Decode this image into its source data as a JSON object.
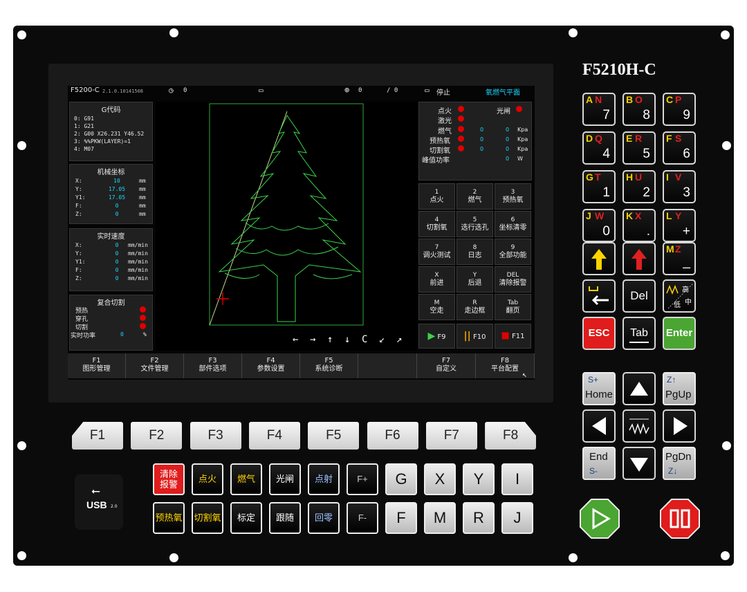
{
  "model": "F5210H-C",
  "status_bar": {
    "product": "F5200-C",
    "version": "2.1.0.10141508",
    "speed": "0",
    "coord_a": "0",
    "coord_b": "/ 0",
    "state": "停止",
    "mode": "氧燃气平面"
  },
  "gcode": {
    "title": "G代码",
    "lines": [
      "0: G91",
      "1: G21",
      "2: G00 X26.231 Y46.52",
      "3: %%PKW(LAYER)=1",
      "4: M07"
    ]
  },
  "machine_coords": {
    "title": "机械坐标",
    "rows": [
      {
        "axis": "X:",
        "value": "10",
        "unit": "mm"
      },
      {
        "axis": "Y:",
        "value": "17.05",
        "unit": "mm"
      },
      {
        "axis": "Y1:",
        "value": "17.05",
        "unit": "mm"
      },
      {
        "axis": "F:",
        "value": "0",
        "unit": "mm"
      },
      {
        "axis": "Z:",
        "value": "0",
        "unit": "mm"
      }
    ]
  },
  "real_speed": {
    "title": "实时速度",
    "rows": [
      {
        "axis": "X:",
        "value": "0",
        "unit": "mm/min"
      },
      {
        "axis": "Y:",
        "value": "0",
        "unit": "mm/min"
      },
      {
        "axis": "Y1:",
        "value": "0",
        "unit": "mm/min"
      },
      {
        "axis": "F:",
        "value": "0",
        "unit": "mm/min"
      },
      {
        "axis": "Z:",
        "value": "0",
        "unit": "mm/min"
      }
    ]
  },
  "compound_cut": {
    "title": "复合切割",
    "items": [
      "预热",
      "穿孔",
      "切割"
    ],
    "power_label": "实时功率",
    "power_value": "0",
    "power_unit": "%"
  },
  "io_status": {
    "ignite": "点火",
    "shutter": "光闸",
    "laser": "激光",
    "gas": "燃气",
    "preheat_o2": "预热氧",
    "cut_o2": "切割氧",
    "peak_power": "峰值功率",
    "v0": "0",
    "kpa": "Kpa",
    "w": "W"
  },
  "soft_keys": [
    {
      "num": "1",
      "label": "点火"
    },
    {
      "num": "2",
      "label": "燃气"
    },
    {
      "num": "3",
      "label": "预热氧"
    },
    {
      "num": "4",
      "label": "切割氧"
    },
    {
      "num": "5",
      "label": "选行选孔"
    },
    {
      "num": "6",
      "label": "坐标清零"
    },
    {
      "num": "7",
      "label": "调火测试"
    },
    {
      "num": "8",
      "label": "日志"
    },
    {
      "num": "9",
      "label": "全部功能"
    },
    {
      "num": "X",
      "label": "前进"
    },
    {
      "num": "Y",
      "label": "后退"
    },
    {
      "num": "DEL",
      "label": "清除报警"
    },
    {
      "num": "M",
      "label": "空走"
    },
    {
      "num": "R",
      "label": "走边框"
    },
    {
      "num": "Tab",
      "label": "翻页"
    }
  ],
  "run_keys": {
    "f9": "F9",
    "f10": "F10",
    "f11": "F11"
  },
  "view_controls": [
    "←",
    "→",
    "↑",
    "↓",
    "C",
    "↙",
    "↗"
  ],
  "f_bar": [
    {
      "key": "F1",
      "label": "图形管理"
    },
    {
      "key": "F2",
      "label": "文件管理"
    },
    {
      "key": "F3",
      "label": "部件选项"
    },
    {
      "key": "F4",
      "label": "参数设置"
    },
    {
      "key": "F5",
      "label": "系统诊断"
    },
    {
      "key": "",
      "label": ""
    },
    {
      "key": "F7",
      "label": "自定义"
    },
    {
      "key": "F8",
      "label": "平台配置"
    }
  ],
  "hard_f_keys": [
    "F1",
    "F2",
    "F3",
    "F4",
    "F5",
    "F6",
    "F7",
    "F8"
  ],
  "func_keys": {
    "row1": [
      "清除\n报警",
      "点火",
      "燃气",
      "光闸",
      "点射",
      "F+",
      "G",
      "X",
      "Y",
      "I"
    ],
    "row2": [
      "预热氧",
      "切割氧",
      "标定",
      "跟随",
      "回零",
      "F-",
      "F",
      "M",
      "R",
      "J"
    ]
  },
  "usb": {
    "label": "USB",
    "ver": "2.0"
  },
  "keypad": [
    {
      "a": "A",
      "b": "N",
      "m": "7"
    },
    {
      "a": "B",
      "b": "O",
      "m": "8"
    },
    {
      "a": "C",
      "b": "P",
      "m": "9"
    },
    {
      "a": "D",
      "b": "Q",
      "m": "4"
    },
    {
      "a": "E",
      "b": "R",
      "m": "5"
    },
    {
      "a": "F",
      "b": "S",
      "m": "6"
    },
    {
      "a": "G",
      "b": "T",
      "m": "1"
    },
    {
      "a": "H",
      "b": "U",
      "m": "2"
    },
    {
      "a": "I",
      "b": "V",
      "m": "3"
    },
    {
      "a": "J",
      "b": "W",
      "m": "0"
    },
    {
      "a": "K",
      "b": "X",
      "m": "."
    },
    {
      "a": "L",
      "b": "Y",
      "m": "+"
    }
  ],
  "keys": {
    "m": "M",
    "z": "Z",
    "minus": "_",
    "del": "Del",
    "high": "高",
    "low": "低",
    "mid": "中",
    "esc": "ESC",
    "tab": "Tab",
    "enter": "Enter",
    "home_top": "S+",
    "home": "Home",
    "pgup_top": "Z↑",
    "pgup": "PgUp",
    "end": "End",
    "end_bot": "S-",
    "pgdn": "PgDn",
    "pgdn_bot": "Z↓"
  },
  "colors": {
    "panel": "#0b0b0b",
    "green": "#4aa532",
    "red": "#e00000",
    "yellow": "#ffd400",
    "graphic": "#3bd34a"
  }
}
